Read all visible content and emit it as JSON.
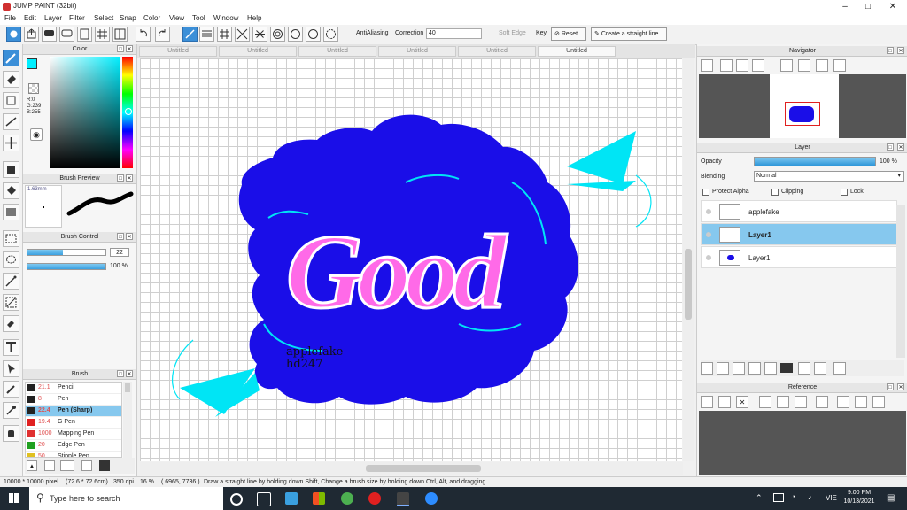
{
  "window": {
    "title": "JUMP PAINT (32bit)"
  },
  "menu": [
    "File",
    "Edit",
    "Layer",
    "Filter",
    "Select",
    "Snap",
    "Color",
    "View",
    "Tool",
    "Window",
    "Help"
  ],
  "tool_options": {
    "antialiasing_label": "AntiAliasing",
    "correction_label": "Correction",
    "correction_value": "40",
    "soft_edge_label": "Soft Edge",
    "key_label": "Key",
    "reset_label": "Reset",
    "straight_line_label": "Create a straight line"
  },
  "color_panel": {
    "title": "Color",
    "r": "R:0",
    "g": "G:239",
    "b": "B:255",
    "main_color": "#00efff",
    "sub_color": "#ff00ff"
  },
  "brush_preview": {
    "title": "Brush Preview",
    "size": "1.63mm"
  },
  "brush_control": {
    "title": "Brush Control",
    "size_value": "22",
    "opacity_value": "100 %",
    "size_fraction": 0.45,
    "opacity_fraction": 1.0
  },
  "brush_list": {
    "title": "Brush",
    "items": [
      {
        "size": "21.1",
        "name": "Pencil",
        "color": "#222222"
      },
      {
        "size": "8",
        "name": "Pen",
        "color": "#222222"
      },
      {
        "size": "22.4",
        "name": "Pen (Sharp)",
        "color": "#222222"
      },
      {
        "size": "19.4",
        "name": "G Pen",
        "color": "#e02020"
      },
      {
        "size": "1000",
        "name": "Mapping Pen",
        "color": "#e03030"
      },
      {
        "size": "20",
        "name": "Edge Pen",
        "color": "#20a020"
      },
      {
        "size": "50",
        "name": "Stipple Pen",
        "color": "#e0c020"
      }
    ],
    "selected_index": 2
  },
  "tabs": [
    "Untitled",
    "Untitled",
    "Untitled",
    "Untitled",
    "Untitled",
    "Untitled"
  ],
  "active_tab": 5,
  "canvas_text": {
    "line1": "applefake",
    "line2": "hd247",
    "art_word": "Good"
  },
  "navigator": {
    "title": "Navigator"
  },
  "layer_panel": {
    "title": "Layer",
    "opacity_label": "Opacity",
    "opacity_value": "100 %",
    "opacity_fraction": 1.0,
    "blending_label": "Blending",
    "blending_value": "Normal",
    "protect_alpha_label": "Protect Alpha",
    "clipping_label": "Clipping",
    "lock_label": "Lock",
    "layers": [
      {
        "name": "applefake"
      },
      {
        "name": "Layer1"
      },
      {
        "name": "Layer1"
      }
    ],
    "selected_index": 1
  },
  "reference": {
    "title": "Reference"
  },
  "status": {
    "canvas_size": "10000 * 10000 pixel",
    "size_mm": "(72.6 * 72.6cm)",
    "dpi": "350 dpi",
    "zoom": "16 %",
    "cursor": "( 6965, 7736 )",
    "hint": "Draw a straight line by holding down Shift, Change a brush size by holding down Ctrl, Alt, and dragging"
  },
  "taskbar": {
    "search_placeholder": "Type here to search",
    "lang": "VIE",
    "time": "9:00 PM",
    "date": "10/13/2021"
  },
  "colors": {
    "accent": "#3b8fd8",
    "blob": "#1a0ee8",
    "cyan": "#00e5f5",
    "magenta": "#ff1fe0"
  }
}
